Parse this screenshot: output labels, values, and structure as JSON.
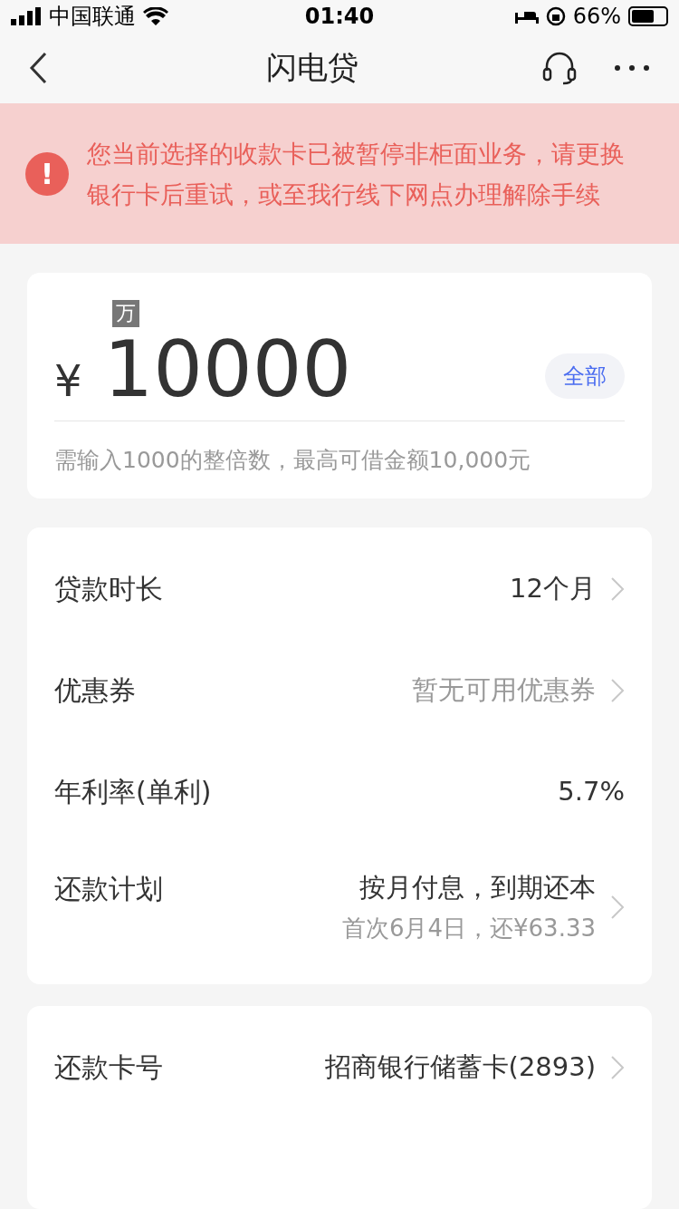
{
  "status_bar": {
    "carrier": "中国联通",
    "time": "01:40",
    "battery": "66%"
  },
  "nav": {
    "title": "闪电贷"
  },
  "alert": {
    "text": "您当前选择的收款卡已被暂停非柜面业务，请更换银行卡后重试，或至我行线下网点办理解除手续",
    "icon": "!"
  },
  "amount": {
    "unit_tag": "万",
    "currency": "¥",
    "value": "10000",
    "all_button": "全部",
    "hint": "需输入1000的整倍数，最高可借金额10,000元"
  },
  "loan_rows": [
    {
      "label": "贷款时长",
      "value": "12个月",
      "kind": "link",
      "muted": false
    },
    {
      "label": "优惠券",
      "value": "暂无可用优惠券",
      "kind": "link",
      "muted": true
    },
    {
      "label": "年利率(单利)",
      "value": "5.7%",
      "kind": "plain",
      "muted": false
    },
    {
      "label": "还款计划",
      "value": "按月付息，到期还本",
      "subvalue": "首次6月4日，还¥63.33",
      "kind": "link",
      "muted": false
    }
  ],
  "card_rows": [
    {
      "label": "还款卡号",
      "value": "招商银行储蓄卡(2893)",
      "kind": "link",
      "muted": false
    }
  ]
}
